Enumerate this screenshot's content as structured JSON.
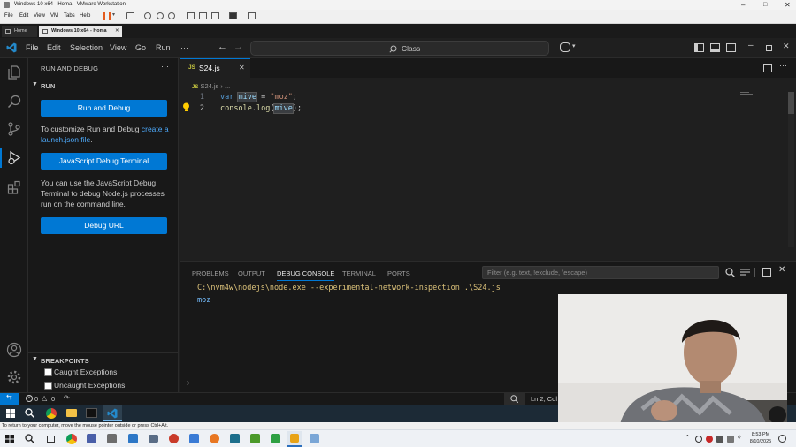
{
  "vm": {
    "title": "Windows 10 x64 - Homa - VMware Workstation",
    "menu": [
      "File",
      "Edit",
      "View",
      "VM",
      "Tabs",
      "Help"
    ],
    "tabs": [
      "Home",
      "Windows 10 x64 - Homa"
    ],
    "hint": "To return to your computer, move the mouse pointer outside or press Ctrl+Alt."
  },
  "vscode": {
    "menu": [
      "File",
      "Edit",
      "Selection",
      "View",
      "Go",
      "Run",
      "···"
    ],
    "search_placeholder": "Class",
    "sidebar": {
      "header": "RUN AND DEBUG",
      "section": "RUN",
      "run_button": "Run and Debug",
      "customize_text": "To customize Run and Debug ",
      "customize_link": "create a launch.json file",
      "customize_end": ".",
      "js_terminal_button": "JavaScript Debug Terminal",
      "js_terminal_text": "You can use the JavaScript Debug Terminal to debug Node.js processes run on the command line.",
      "debug_url_button": "Debug URL",
      "breakpoints_header": "BREAKPOINTS",
      "breakpoints": [
        {
          "label": "Caught Exceptions",
          "checked": false
        },
        {
          "label": "Uncaught Exceptions",
          "checked": false
        }
      ]
    },
    "editor": {
      "tab_name": "S24.js",
      "breadcrumb_file": "S24.js",
      "breadcrumb_rest": "...",
      "lines": [
        {
          "num": "1",
          "parts": [
            [
              "var ",
              "kw"
            ],
            [
              "mive",
              "var"
            ],
            [
              " = ",
              "op"
            ],
            [
              "\"moz\"",
              "str"
            ],
            [
              ";",
              "op"
            ]
          ]
        },
        {
          "num": "2",
          "parts": [
            [
              "console",
              "fn"
            ],
            [
              ".",
              "op"
            ],
            [
              "log",
              "fn"
            ],
            [
              "(",
              "op"
            ],
            [
              "mive",
              "var"
            ],
            [
              ");",
              "op"
            ]
          ]
        }
      ]
    },
    "panel": {
      "tabs": [
        "PROBLEMS",
        "OUTPUT",
        "DEBUG CONSOLE",
        "TERMINAL",
        "PORTS"
      ],
      "active_tab": "DEBUG CONSOLE",
      "filter_placeholder": "Filter (e.g. text, !exclude, \\escape)",
      "output_command": "C:\\nvm4w\\nodejs\\node.exe --experimental-network-inspection .\\S24.js",
      "output_result": "moz",
      "prompt": "›"
    },
    "status": {
      "errors": "0",
      "warnings": "0",
      "position": "Ln 2, Col"
    }
  },
  "host": {
    "time": "8:53 PM",
    "date": "8/10/2025"
  },
  "colors": {
    "accent": "#0078d4",
    "keyword": "#569cd6",
    "string": "#ce9178",
    "variable": "#9cdcfe",
    "function": "#dcdcaa",
    "terminal_command": "#dcc27a",
    "terminal_result": "#75beff"
  }
}
